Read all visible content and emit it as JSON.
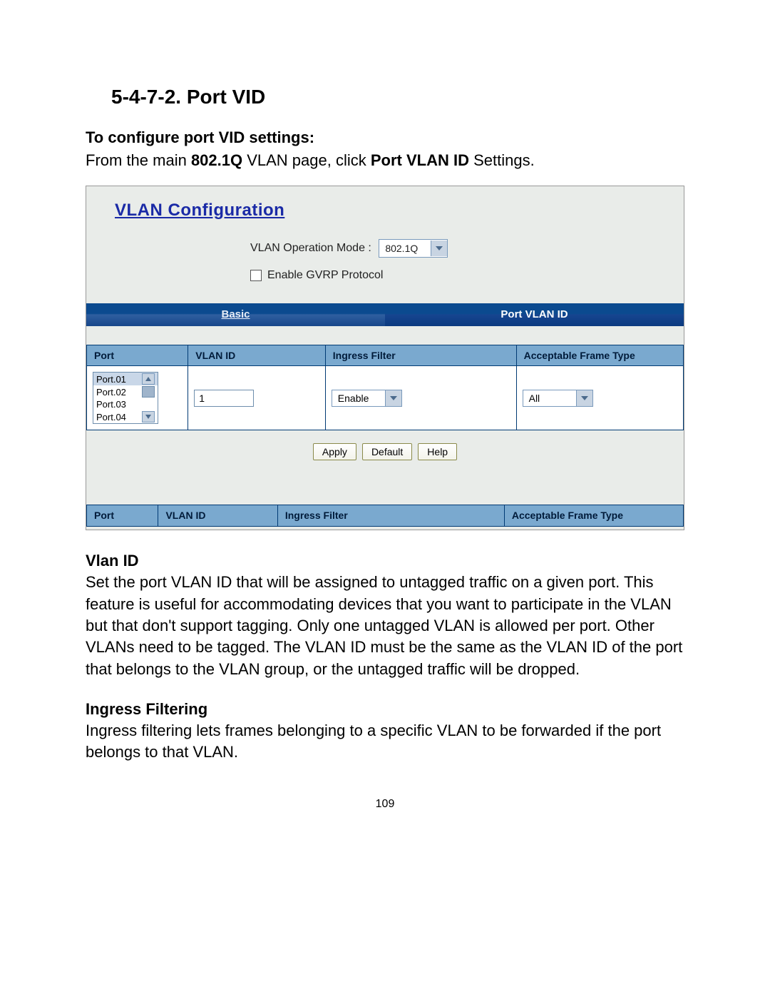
{
  "heading": "5-4-7-2. Port VID",
  "intro_sub": "To configure port VID settings:",
  "intro_para_pre": "From the main ",
  "intro_para_bold1": "802.1Q",
  "intro_para_mid": " VLAN page, click ",
  "intro_para_bold2": "Port VLAN ID",
  "intro_para_post": " Settings.",
  "ss": {
    "title": "VLAN Configuration",
    "op_mode_label": "VLAN Operation Mode :",
    "op_mode_value": "802.1Q",
    "gvrp_label": "Enable GVRP Protocol",
    "tabs": {
      "basic": "Basic",
      "pvid": "Port VLAN ID"
    },
    "columns": {
      "port": "Port",
      "vlan_id": "VLAN ID",
      "ingress": "Ingress Filter",
      "frame": "Acceptable Frame Type"
    },
    "ports": [
      "Port.01",
      "Port.02",
      "Port.03",
      "Port.04"
    ],
    "vlan_id_value": "1",
    "ingress_value": "Enable",
    "frame_value": "All",
    "buttons": {
      "apply": "Apply",
      "default": "Default",
      "help": "Help"
    }
  },
  "sections": {
    "vlan_id_title": "Vlan ID",
    "vlan_id_body": "Set the port VLAN ID that will be assigned to untagged traffic on a given port. This feature is useful for accommodating devices that you want to participate in the VLAN but that don't support tagging.  Only one untagged VLAN is allowed per port.  Other VLANs need to be tagged. The VLAN ID must be the same as the VLAN ID of the port that belongs to the VLAN group, or the untagged traffic will be dropped.",
    "ingress_title": "Ingress Filtering",
    "ingress_body": "Ingress filtering lets frames belonging to a specific VLAN to be forwarded if the port belongs to that VLAN."
  },
  "page_number": "109"
}
